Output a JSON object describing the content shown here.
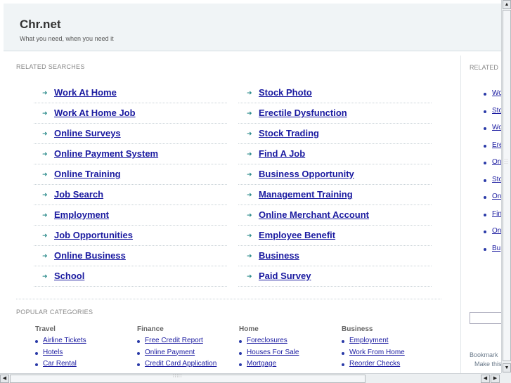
{
  "header": {
    "title": "Chr.net",
    "tagline": "What you need, when you need it"
  },
  "related_searches": {
    "label": "RELATED SEARCHES",
    "left": [
      "Work At Home",
      "Work At Home Job",
      "Online Surveys",
      "Online Payment System",
      "Online Training",
      "Job Search",
      "Employment",
      "Job Opportunities",
      "Online Business",
      "School"
    ],
    "right": [
      "Stock Photo",
      "Erectile Dysfunction",
      "Stock Trading",
      "Find A Job",
      "Business Opportunity",
      "Management Training",
      "Online Merchant Account",
      "Employee Benefit",
      "Business",
      "Paid Survey"
    ]
  },
  "popular_categories": {
    "label": "POPULAR CATEGORIES",
    "columns": [
      {
        "title": "Travel",
        "items": [
          "Airline Tickets",
          "Hotels",
          "Car Rental"
        ]
      },
      {
        "title": "Finance",
        "items": [
          "Free Credit Report",
          "Online Payment",
          "Credit Card Application"
        ]
      },
      {
        "title": "Home",
        "items": [
          "Foreclosures",
          "Houses For Sale",
          "Mortgage"
        ]
      },
      {
        "title": "Business",
        "items": [
          "Employment",
          "Work From Home",
          "Reorder Checks"
        ]
      }
    ]
  },
  "sidebar": {
    "label": "RELATED",
    "items": [
      "Wo",
      "Sto",
      "Wo",
      "Ere",
      "On",
      "Sto",
      "On",
      "Fin",
      "On",
      "Bu"
    ],
    "bookmark_line1": "Bookmark",
    "bookmark_line2": "Make this"
  },
  "icons": {
    "search_arrow": "arrow-right-icon",
    "category_bullet": "bullet-icon"
  },
  "colors": {
    "link": "#1a1aa0",
    "header_bg": "#f0f4f6",
    "arrow": "#2a8a8a"
  }
}
